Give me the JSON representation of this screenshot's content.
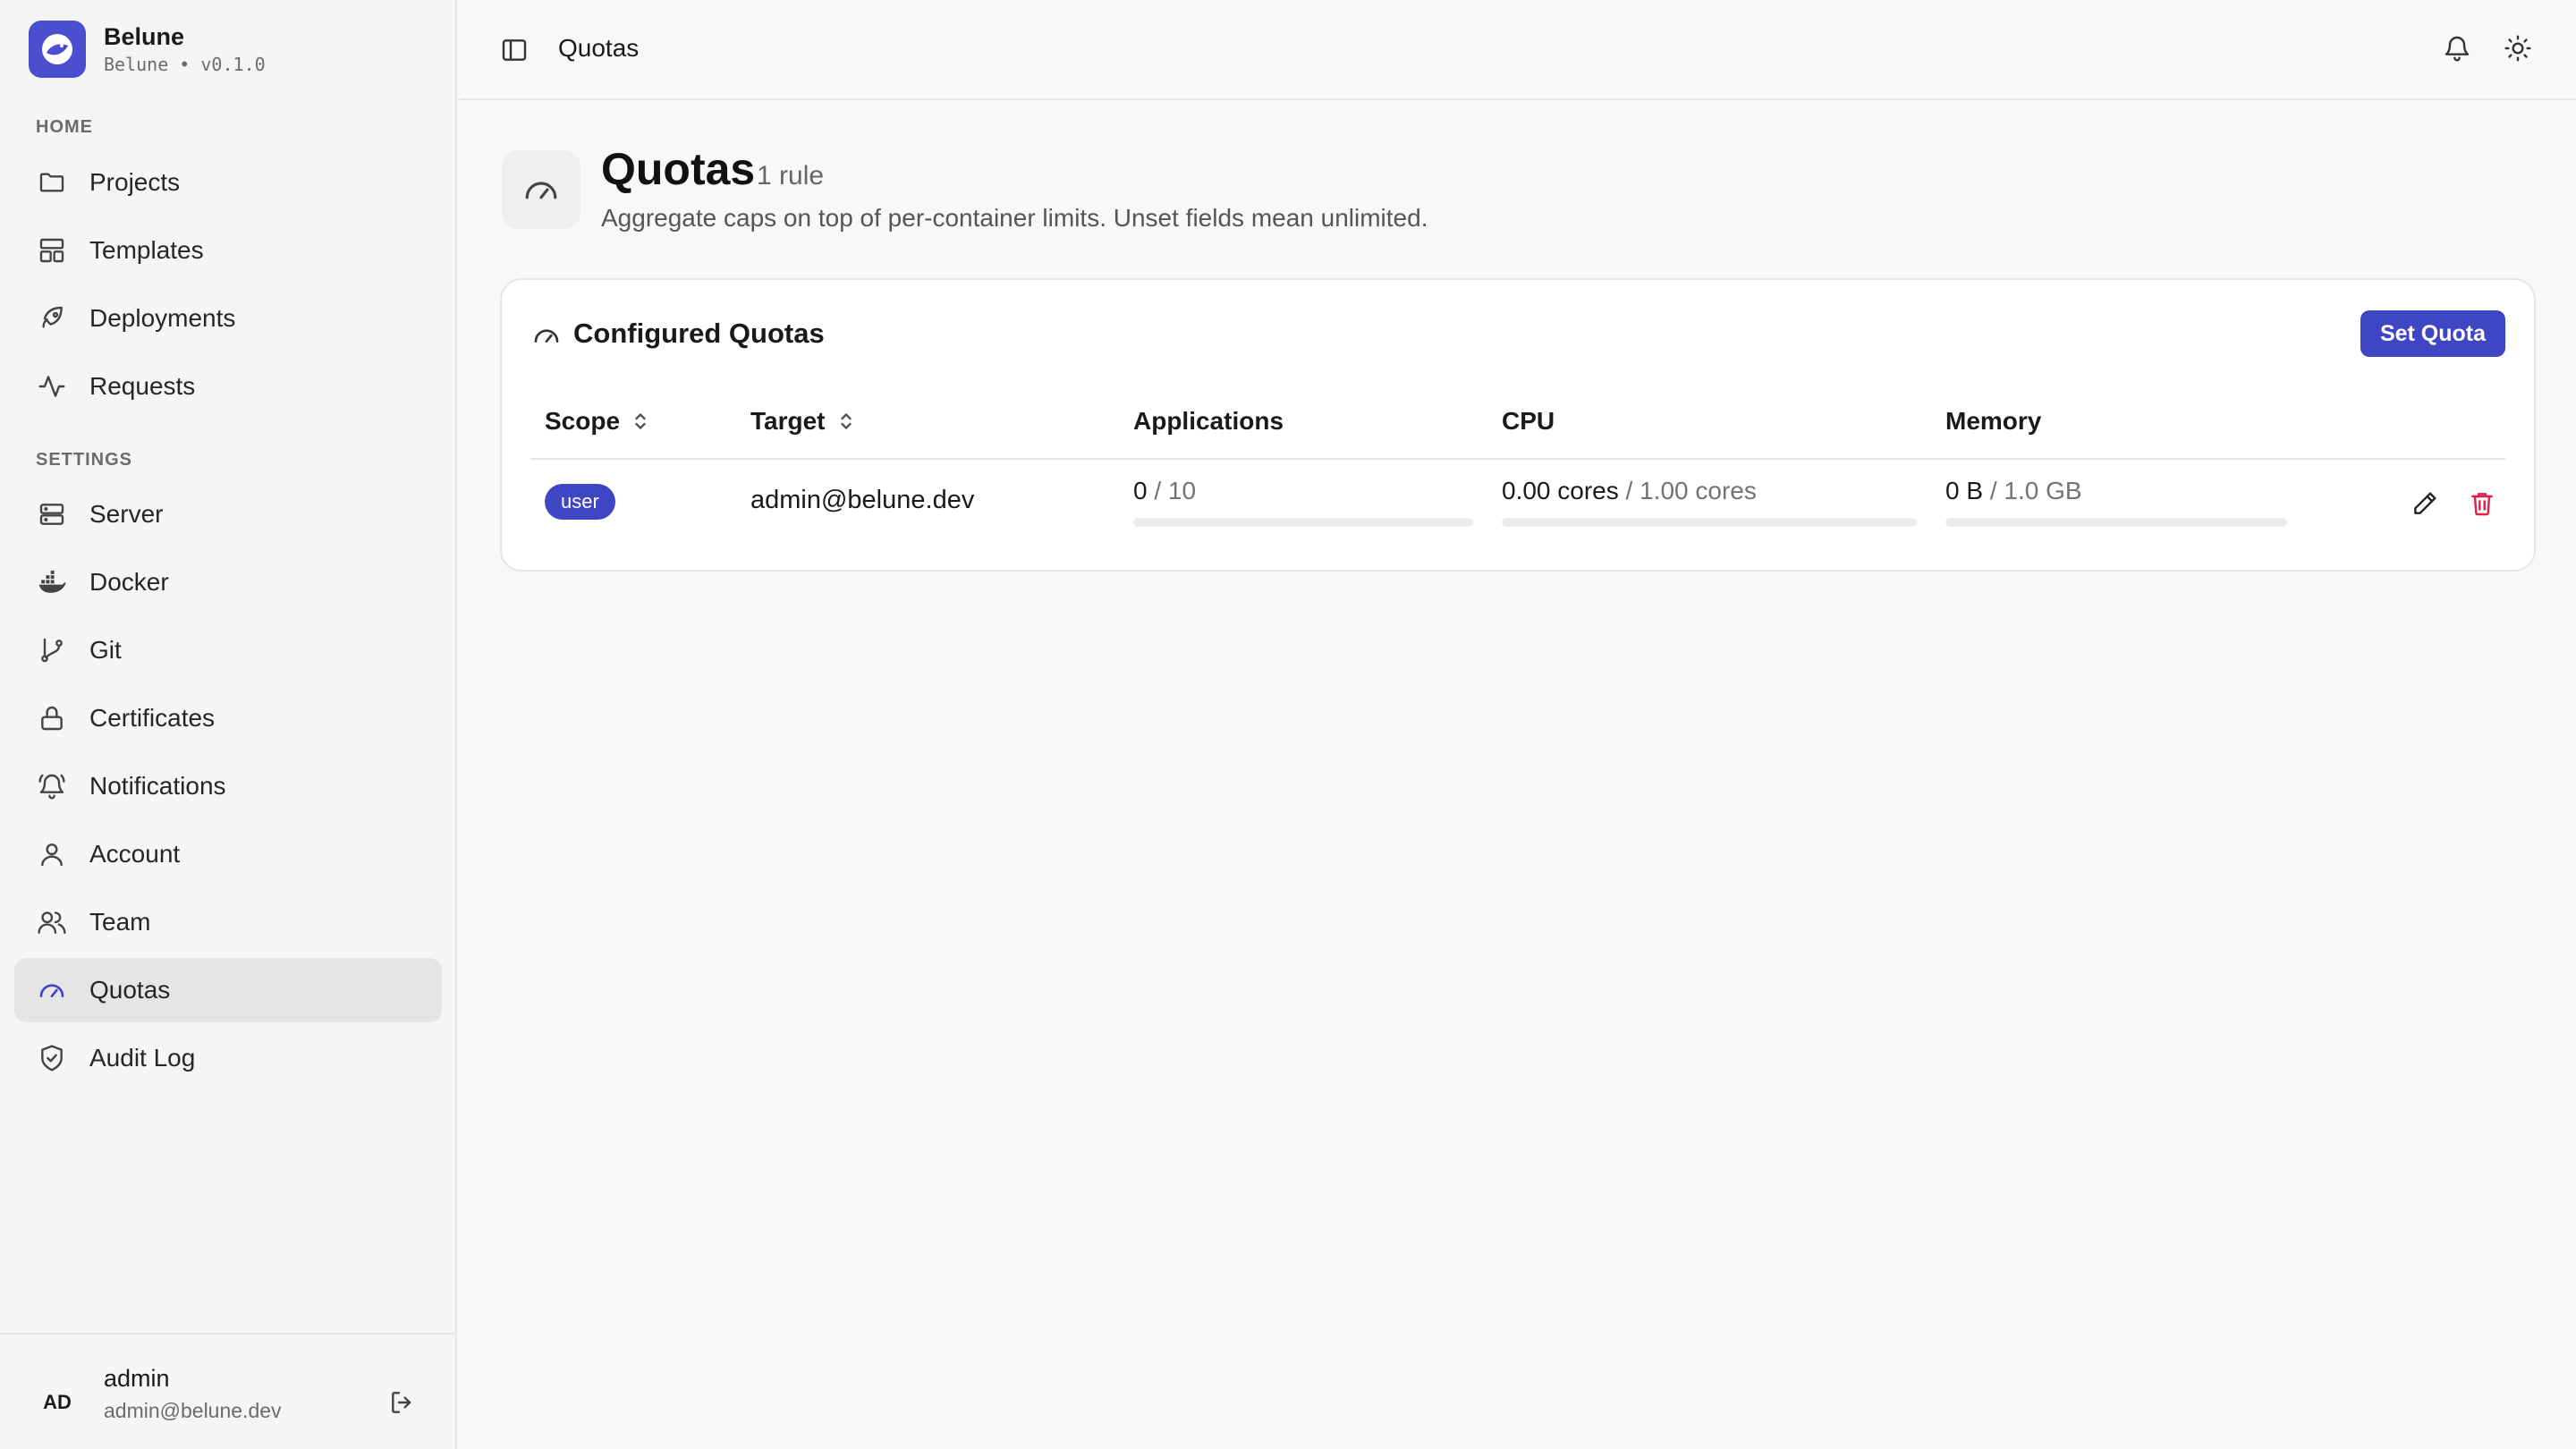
{
  "app": {
    "name": "Belune",
    "subtitle": "Belune • v0.1.0"
  },
  "sidebar": {
    "sections": [
      {
        "label": "HOME"
      },
      {
        "label": "SETTINGS"
      }
    ],
    "home_items": [
      {
        "label": "Projects",
        "icon": "folder-icon"
      },
      {
        "label": "Templates",
        "icon": "templates-icon"
      },
      {
        "label": "Deployments",
        "icon": "rocket-icon"
      },
      {
        "label": "Requests",
        "icon": "activity-icon"
      }
    ],
    "settings_items": [
      {
        "label": "Server",
        "icon": "server-icon"
      },
      {
        "label": "Docker",
        "icon": "docker-icon"
      },
      {
        "label": "Git",
        "icon": "git-branch-icon"
      },
      {
        "label": "Certificates",
        "icon": "lock-icon"
      },
      {
        "label": "Notifications",
        "icon": "bell-ring-icon"
      },
      {
        "label": "Account",
        "icon": "user-icon"
      },
      {
        "label": "Team",
        "icon": "users-icon"
      },
      {
        "label": "Quotas",
        "icon": "gauge-icon",
        "active": true
      },
      {
        "label": "Audit Log",
        "icon": "shield-check-icon"
      }
    ]
  },
  "user": {
    "initials": "AD",
    "name": "admin",
    "email": "admin@belune.dev"
  },
  "topbar": {
    "title": "Quotas"
  },
  "page": {
    "title": "Quotas",
    "count": "1 rule",
    "description": "Aggregate caps on top of per-container limits. Unset fields mean unlimited."
  },
  "card": {
    "title": "Configured Quotas",
    "set_quota_label": "Set Quota",
    "columns": [
      "Scope",
      "Target",
      "Applications",
      "CPU",
      "Memory"
    ],
    "rows": [
      {
        "scope": "user",
        "target": "admin@belune.dev",
        "applications": {
          "used": "0",
          "limit": "/ 10",
          "fraction": 0
        },
        "cpu": {
          "used": "0.00 cores",
          "limit": "/ 1.00 cores",
          "fraction": 0
        },
        "memory": {
          "used": "0 B",
          "limit": "/ 1.0 GB",
          "fraction": 0
        }
      }
    ]
  },
  "colors": {
    "accent": "#3f46c4",
    "danger": "#e11d48",
    "active_nav": "#e5e5e5"
  }
}
